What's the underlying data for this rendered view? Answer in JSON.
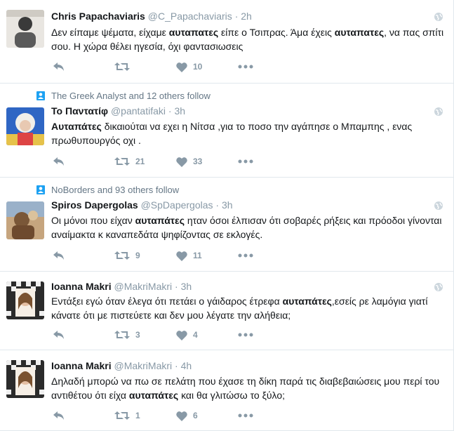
{
  "tweets": [
    {
      "context": null,
      "name": "Chris Papachaviaris",
      "handle": "@C_Papachaviaris",
      "dot": "·",
      "time": "2h",
      "text_parts": [
        {
          "t": "Δεν είπαμε ψέματα, είχαμε "
        },
        {
          "t": "αυταπατες",
          "b": true
        },
        {
          "t": " είπε ο Τσιπρας. Άμα έχεις "
        },
        {
          "t": "αυταπατες",
          "b": true
        },
        {
          "t": ", να πας σπίτι σου. Η χώρα θέλει ηγεσία, όχι φαντασιωσεις"
        }
      ],
      "retweets": "",
      "likes": "10"
    },
    {
      "context": "The Greek Analyst and 12 others follow",
      "name": "Το Παντατίφ",
      "handle": "@pantatifaki",
      "dot": "·",
      "time": "3h",
      "text_parts": [
        {
          "t": "Αυταπάτες",
          "b": true
        },
        {
          "t": " δικαιούται να εχει η Νίτσα ,για το ποσο την αγάπησε ο Μπαμπης , ενας πρωθυπουργός οχι ."
        }
      ],
      "retweets": "21",
      "likes": "33"
    },
    {
      "context": "NoBorders and 93 others follow",
      "name": "Spiros Dapergolas",
      "handle": "@SpDapergolas",
      "dot": "·",
      "time": "3h",
      "text_parts": [
        {
          "t": "Οι μόνοι που είχαν "
        },
        {
          "t": "αυταπάτες",
          "b": true
        },
        {
          "t": " ηταν όσοι έλπισαν ότι σοβαρές ρήξεις και πρόοδοι γίνονται αναίμακτα κ καναπεδάτα ψηφίζοντας σε εκλογές."
        }
      ],
      "retweets": "9",
      "likes": "11"
    },
    {
      "context": null,
      "name": "Ioanna Makri",
      "handle": "@MakriMakri",
      "dot": "·",
      "time": "3h",
      "text_parts": [
        {
          "t": "Εντάξει εγώ όταν έλεγα ότι πετάει ο γάιδαρος έτρεφα "
        },
        {
          "t": "αυταπάτες",
          "b": true
        },
        {
          "t": ",εσείς ρε λαμόγια γιατί κάνατε ότι με πιστεύετε και δεν μου λέγατε την αλήθεια;"
        }
      ],
      "retweets": "3",
      "likes": "4"
    },
    {
      "context": null,
      "name": "Ioanna Makri",
      "handle": "@MakriMakri",
      "dot": "·",
      "time": "4h",
      "text_parts": [
        {
          "t": "Δηλαδή μπορώ να πω σε πελάτη που έχασε τη δίκη παρά τις διαβεβαιώσεις μου περί του αντιθέτου ότι είχα "
        },
        {
          "t": "αυταπάτες",
          "b": true
        },
        {
          "t": " και θα γλιτώσω το ξύλο;"
        }
      ],
      "retweets": "1",
      "likes": "6"
    }
  ],
  "colors": {
    "meta": "#8899a6",
    "text": "#14171a",
    "border": "#e1e8ed",
    "follow_icon": "#1da1f2"
  },
  "icons": [
    "reply-icon",
    "retweet-icon",
    "like-icon",
    "more-icon",
    "globe-icon",
    "follow-icon"
  ]
}
